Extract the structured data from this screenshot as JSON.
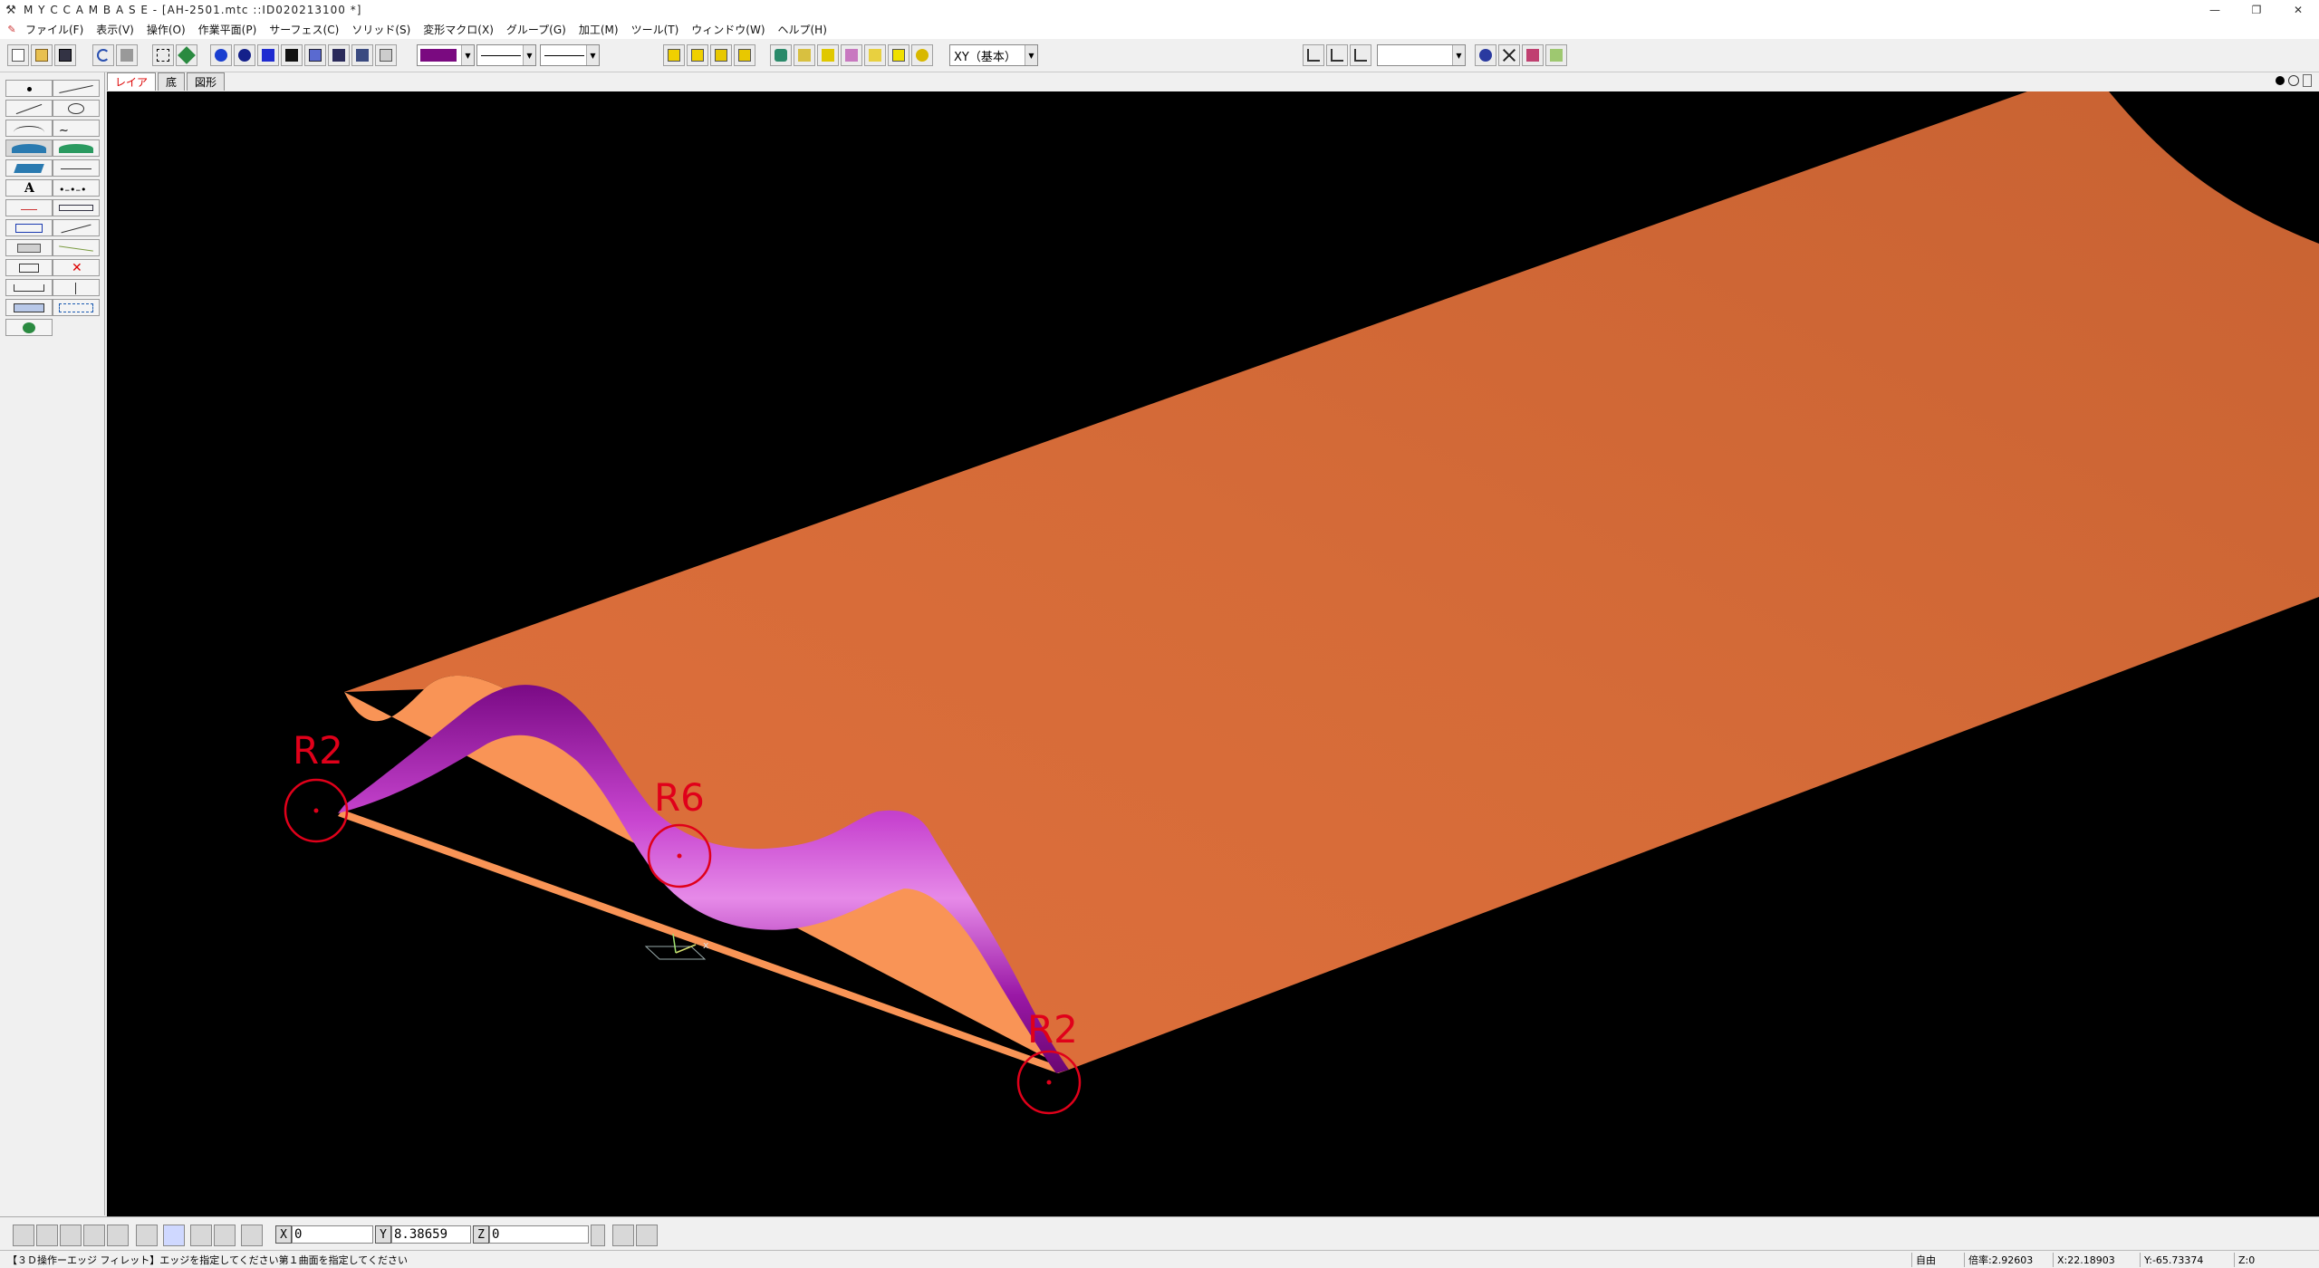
{
  "window": {
    "title": "M Y C  C A M B A S E - [AH-2501.mtc ::ID020213100 *]",
    "controls": [
      "—",
      "❐",
      "✕"
    ]
  },
  "menu": {
    "items": [
      "ファイル(F)",
      "表示(V)",
      "操作(O)",
      "作業平面(P)",
      "サーフェス(C)",
      "ソリッド(S)",
      "変形マクロ(X)",
      "グループ(G)",
      "加工(M)",
      "ツール(T)",
      "ウィンドウ(W)",
      "ヘルプ(H)"
    ],
    "mdi_controls": [
      "–",
      "❐",
      "×"
    ]
  },
  "toolbar": {
    "plane_select": "XY（基本）",
    "color_swatch": "#7a0a80"
  },
  "tabs": [
    "レイア",
    "底",
    "図形"
  ],
  "bottom": {
    "x_label": "X",
    "x_value": "0",
    "y_label": "Y",
    "y_value": "8.38659",
    "z_label": "Z",
    "z_value": "0"
  },
  "status": {
    "message": "【３Ｄ操作ーエッジ フィレット】エッジを指定してください第１曲面を指定してください",
    "mode": "自由",
    "scale": "倍率:2.92603",
    "x": "X:22.18903",
    "y": "Y:-65.73374",
    "z": "Z:0"
  },
  "annotations": [
    {
      "label": "R2"
    },
    {
      "label": "R6"
    },
    {
      "label": "R2"
    }
  ],
  "colors": {
    "surface_top": "#d9683a",
    "surface_front": "#f99456",
    "fillet": "#9b0fa6",
    "annotation": "#e0001a",
    "viewport_bg": "#000000"
  }
}
